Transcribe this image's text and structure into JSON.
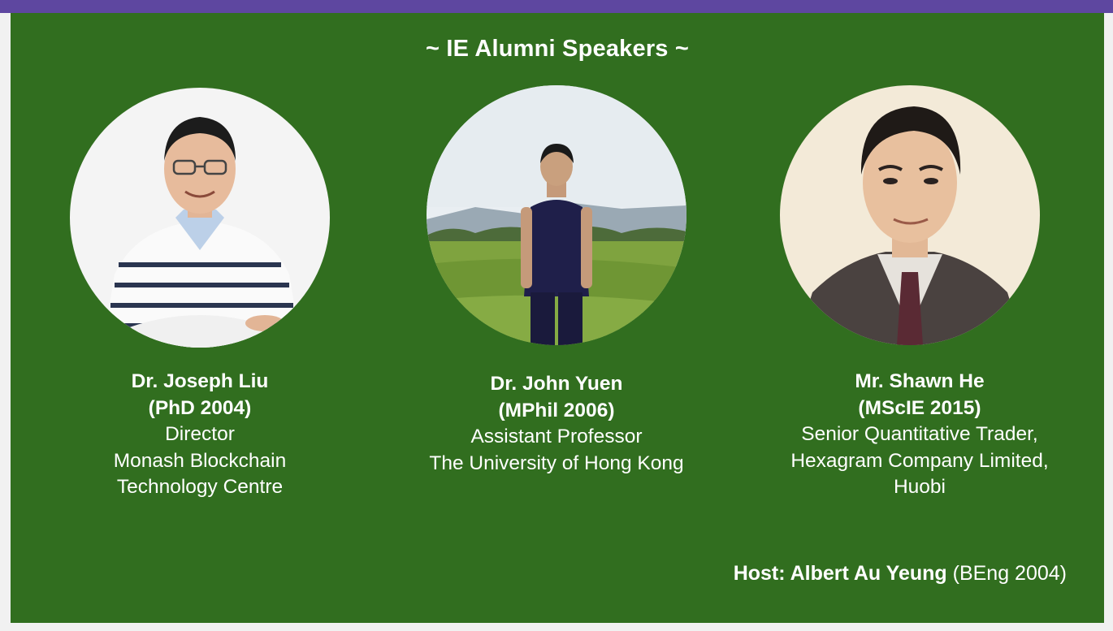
{
  "slide": {
    "title": "~ IE Alumni Speakers ~",
    "speakers": [
      {
        "name": "Dr. Joseph Liu",
        "degree": "(PhD 2004)",
        "lines": [
          "Director",
          "Monash Blockchain",
          "Technology Centre"
        ]
      },
      {
        "name": "Dr. John Yuen",
        "degree": "(MPhil 2006)",
        "lines": [
          "Assistant Professor",
          "The University of Hong Kong"
        ]
      },
      {
        "name": "Mr. Shawn He",
        "degree": "(MScIE 2015)",
        "lines": [
          "Senior Quantitative Trader,",
          "Hexagram Company Limited,",
          "Huobi"
        ]
      }
    ],
    "host": {
      "label": "Host: Albert Au Yeung",
      "degree": "(BEng 2004)"
    }
  },
  "colors": {
    "header_bar": "#5e47a0",
    "slide_background": "#316e1f",
    "text": "#ffffff"
  }
}
